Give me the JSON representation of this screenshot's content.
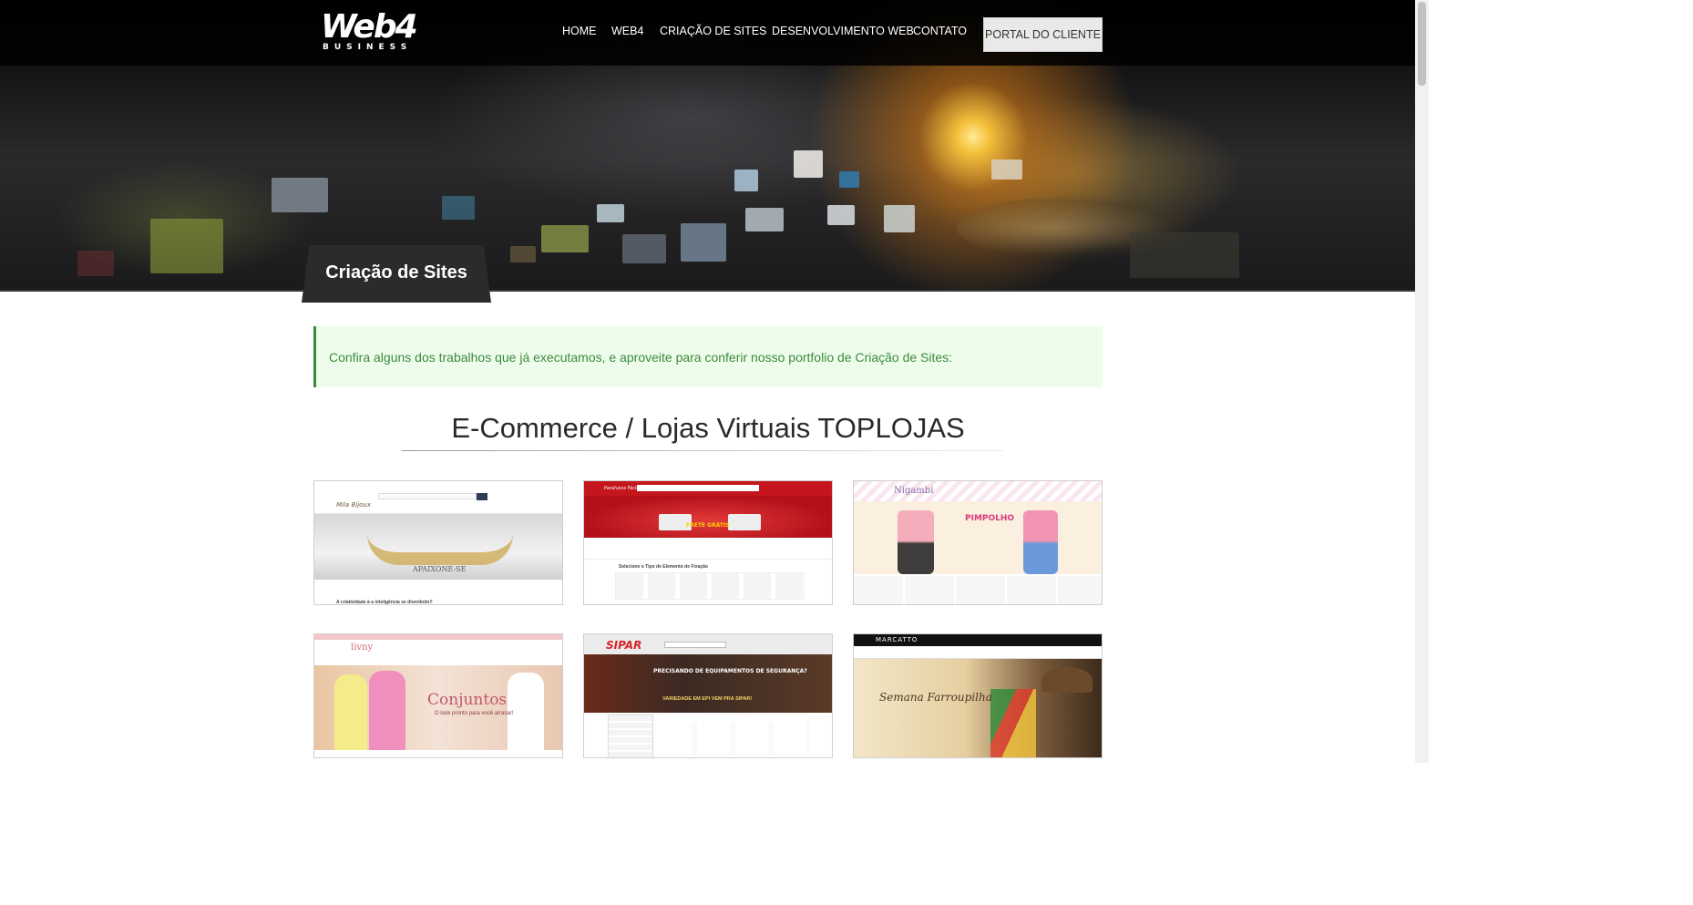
{
  "brand": {
    "name": "Web4",
    "sub": "BUSINESS"
  },
  "nav": {
    "items": [
      {
        "label": "HOME"
      },
      {
        "label": "WEB4"
      },
      {
        "label": "CRIAÇÃO DE SITES"
      },
      {
        "label": "DESENVOLVIMENTO WEB"
      },
      {
        "label": "CONTATO"
      }
    ],
    "portal_button": "PORTAL DO CLIENTE"
  },
  "page": {
    "title": "Criação de Sites",
    "intro": "Confira alguns dos trabalhos que já executamos, e aproveite para conferir nosso portfolio de Criação de Sites:",
    "section_title": "E-Commerce / Lojas Virtuais TOPLOJAS"
  },
  "portfolio": [
    {
      "site": "Mila Bijoux",
      "banner_text": "APAIXONE-SE",
      "footer_text": "A criatividade à a inteligência se divertindo!!"
    },
    {
      "site": "Parafusos Fácil",
      "banner_text": "FRETE GRÁTIS",
      "footer_text": "Selecione o Tipo de Elemento de Fixação"
    },
    {
      "site": "Nigambi",
      "banner_text": "PIMPOLHO",
      "footer_text": ""
    },
    {
      "site": "livny",
      "banner_text": "Conjuntos",
      "footer_text": "O look pronto para você arrasar!"
    },
    {
      "site": "SIPAR",
      "banner_text": "PRECISANDO DE EQUIPAMENTOS DE SEGURANÇA?",
      "footer_text": "VARIEDADE EM EPI VEM PRA SIPAR!"
    },
    {
      "site": "MARCATTO",
      "banner_text": "Semana Farroupilha",
      "footer_text": ""
    }
  ],
  "colors": {
    "intro_text": "#3c8a3c",
    "intro_bg": "#eefcec",
    "tab_bg": "#2b2b2b"
  }
}
